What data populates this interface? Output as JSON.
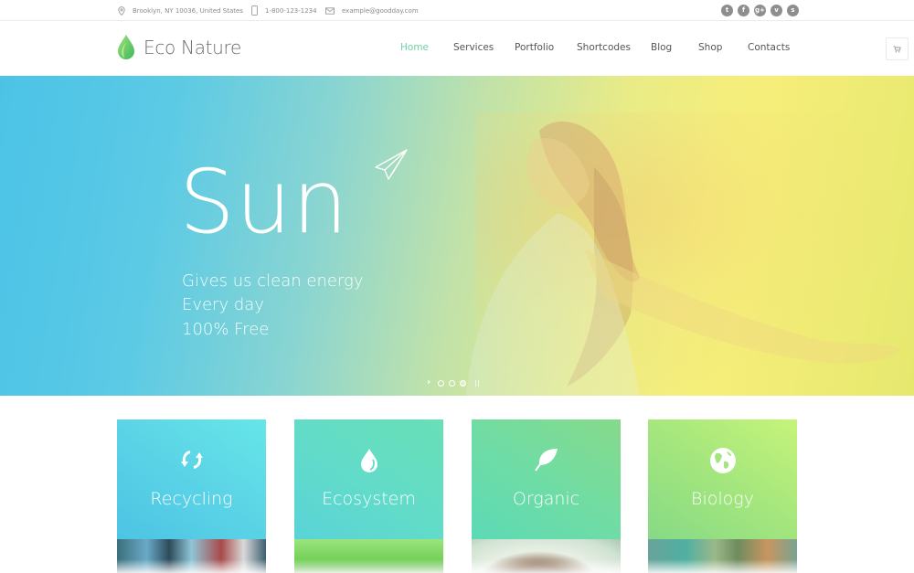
{
  "topbar": {
    "address": "Brooklyn, NY 10036, United States",
    "phone": "1-800-123-1234",
    "email": "example@goodday.com",
    "social": [
      {
        "name": "twitter-icon",
        "glyph": "t"
      },
      {
        "name": "facebook-icon",
        "glyph": "f"
      },
      {
        "name": "google-plus-icon",
        "glyph": "g+"
      },
      {
        "name": "vimeo-icon",
        "glyph": "v"
      },
      {
        "name": "skype-icon",
        "glyph": "s"
      }
    ]
  },
  "header": {
    "logo_text": "Eco Nature",
    "nav": [
      {
        "label": "Home",
        "active": true
      },
      {
        "label": "Services",
        "active": false
      },
      {
        "label": "Portfolio",
        "active": false
      },
      {
        "label": "Shortcodes",
        "active": false
      },
      {
        "label": "Blog",
        "active": false
      },
      {
        "label": "Shop",
        "active": false
      },
      {
        "label": "Contacts",
        "active": false
      }
    ],
    "accent_color": "#6fd3a8"
  },
  "hero": {
    "title": "Sun",
    "lines": [
      "Gives us clean energy",
      "Every day",
      "100% Free"
    ],
    "slides_total": 3,
    "active_slide": 3
  },
  "features": [
    {
      "label": "Recycling",
      "icon": "recycle-icon",
      "from": "#4cc4e4",
      "to": "#64e3e6"
    },
    {
      "label": "Ecosystem",
      "icon": "water-drop-icon",
      "from": "#5fd6d6",
      "to": "#66deba"
    },
    {
      "label": "Organic",
      "icon": "leaf-icon",
      "from": "#62dcb2",
      "to": "#84da8c"
    },
    {
      "label": "Biology",
      "icon": "globe-icon",
      "from": "#86d985",
      "to": "#c4f27a"
    }
  ]
}
